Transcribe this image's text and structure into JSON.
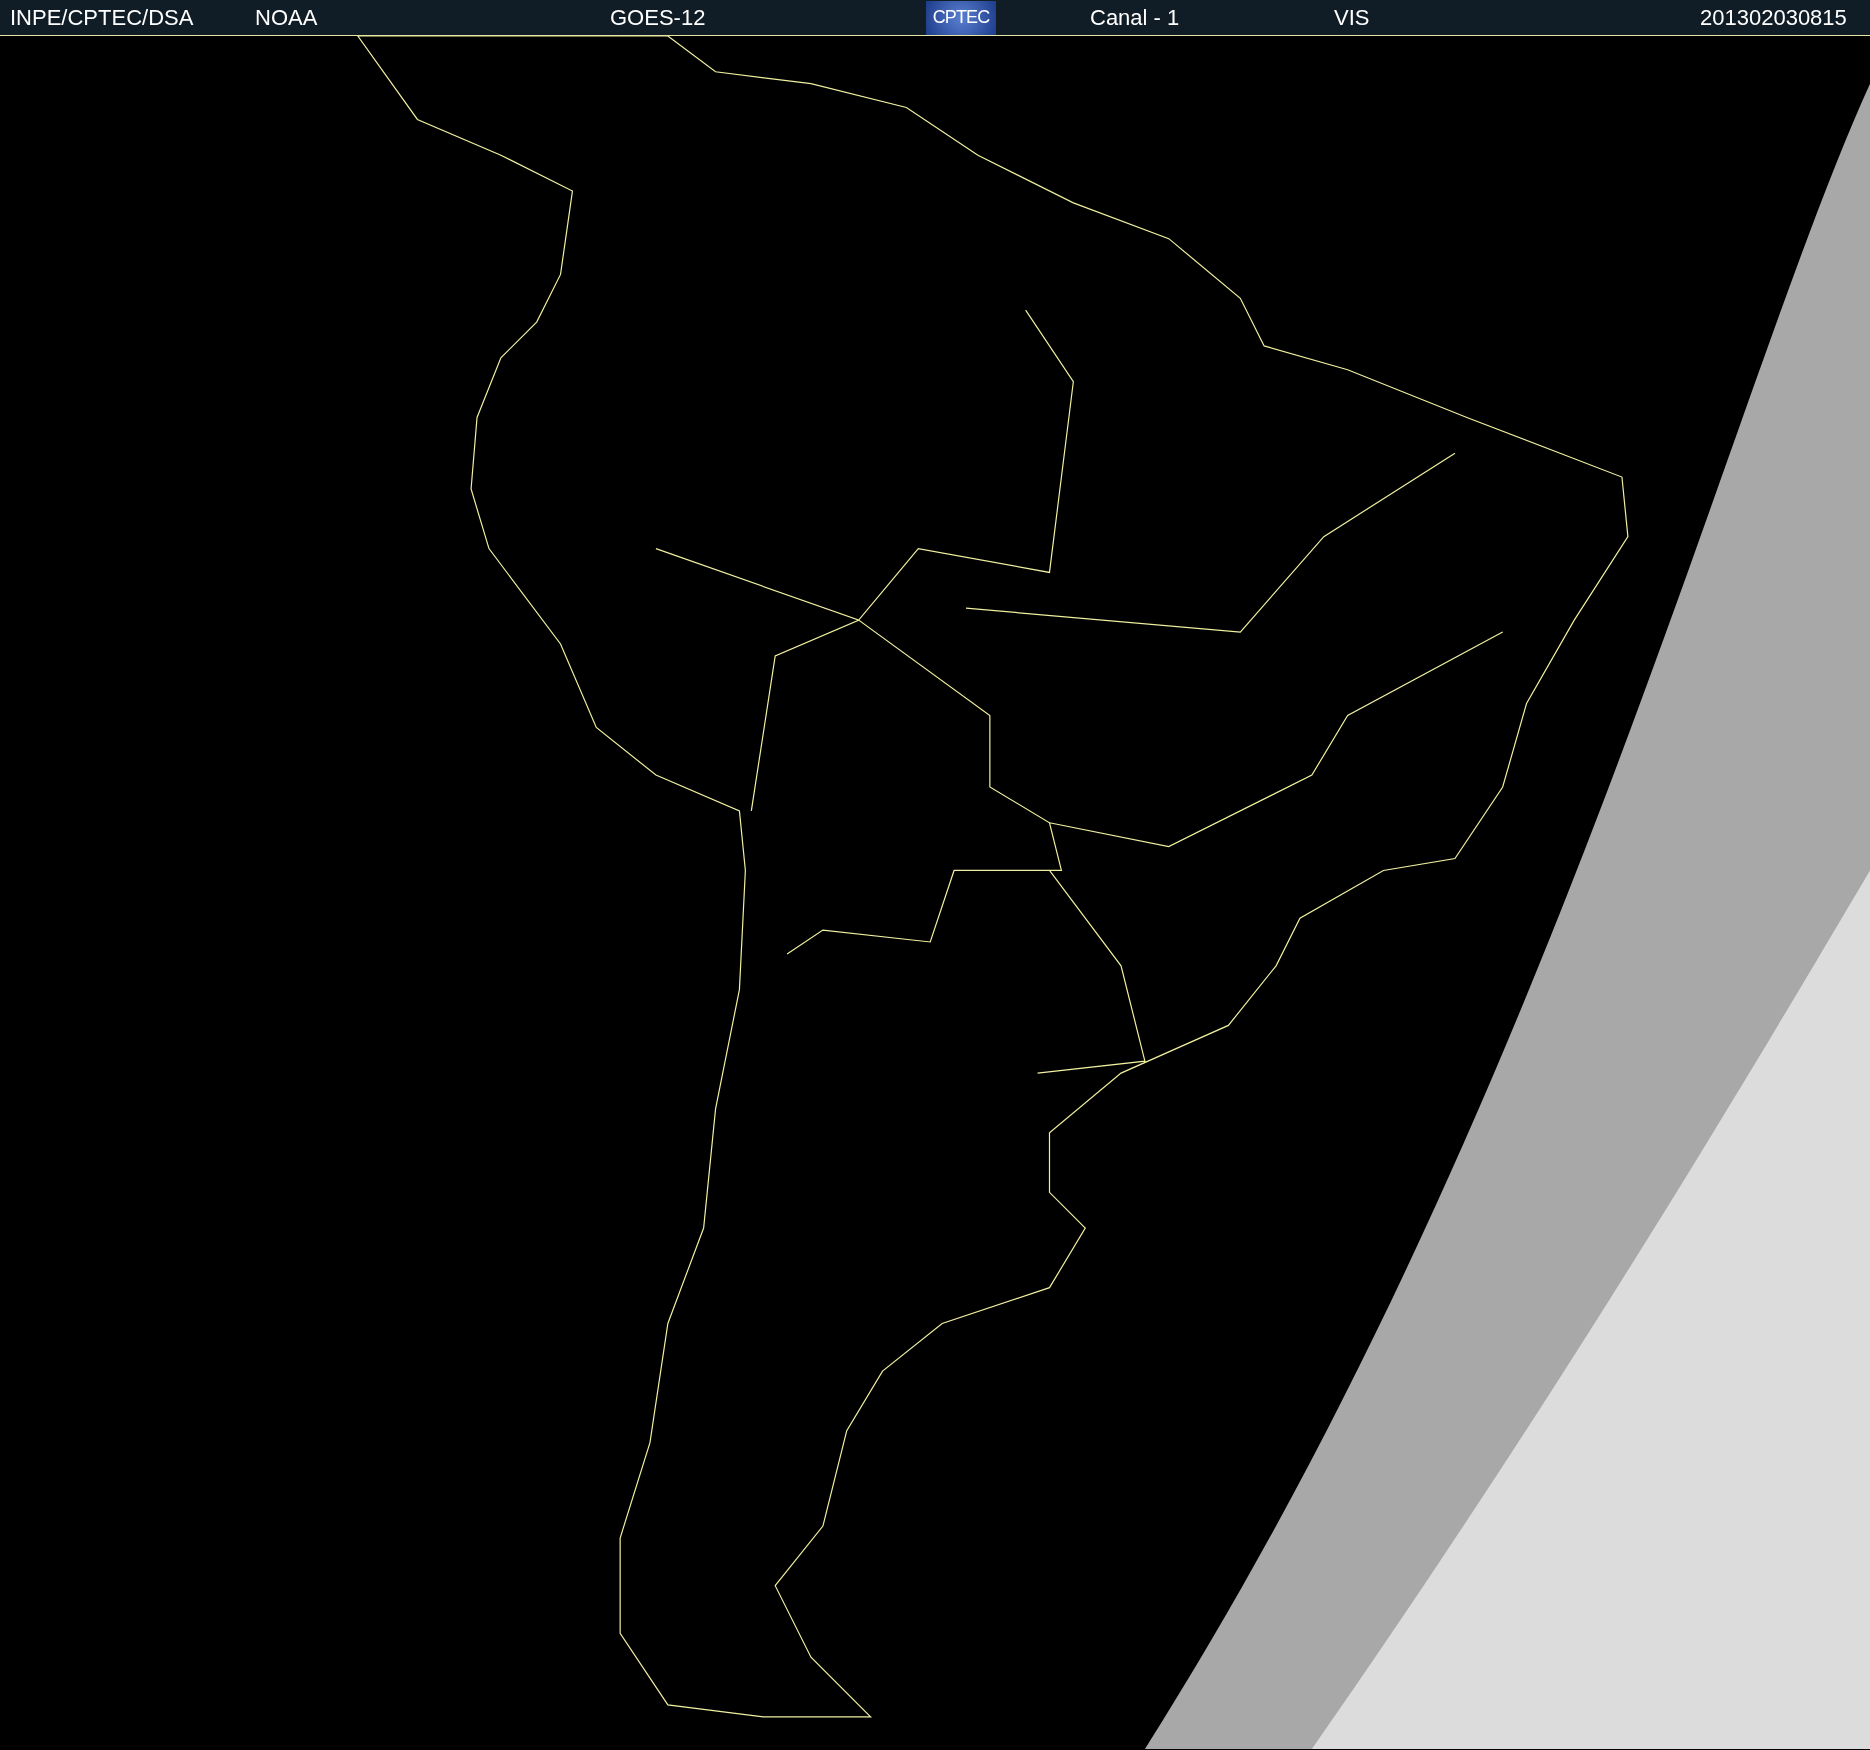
{
  "header": {
    "items": [
      {
        "kind": "text",
        "label": "INPE/CPTEC/DSA"
      },
      {
        "kind": "text",
        "label": "NOAA"
      },
      {
        "kind": "text",
        "label": "GOES-12"
      },
      {
        "kind": "logo",
        "label": "CPTEC"
      },
      {
        "kind": "text",
        "label": "Canal - 1"
      },
      {
        "kind": "text",
        "label": "VIS"
      },
      {
        "kind": "text",
        "label": "201302030815"
      }
    ]
  }
}
